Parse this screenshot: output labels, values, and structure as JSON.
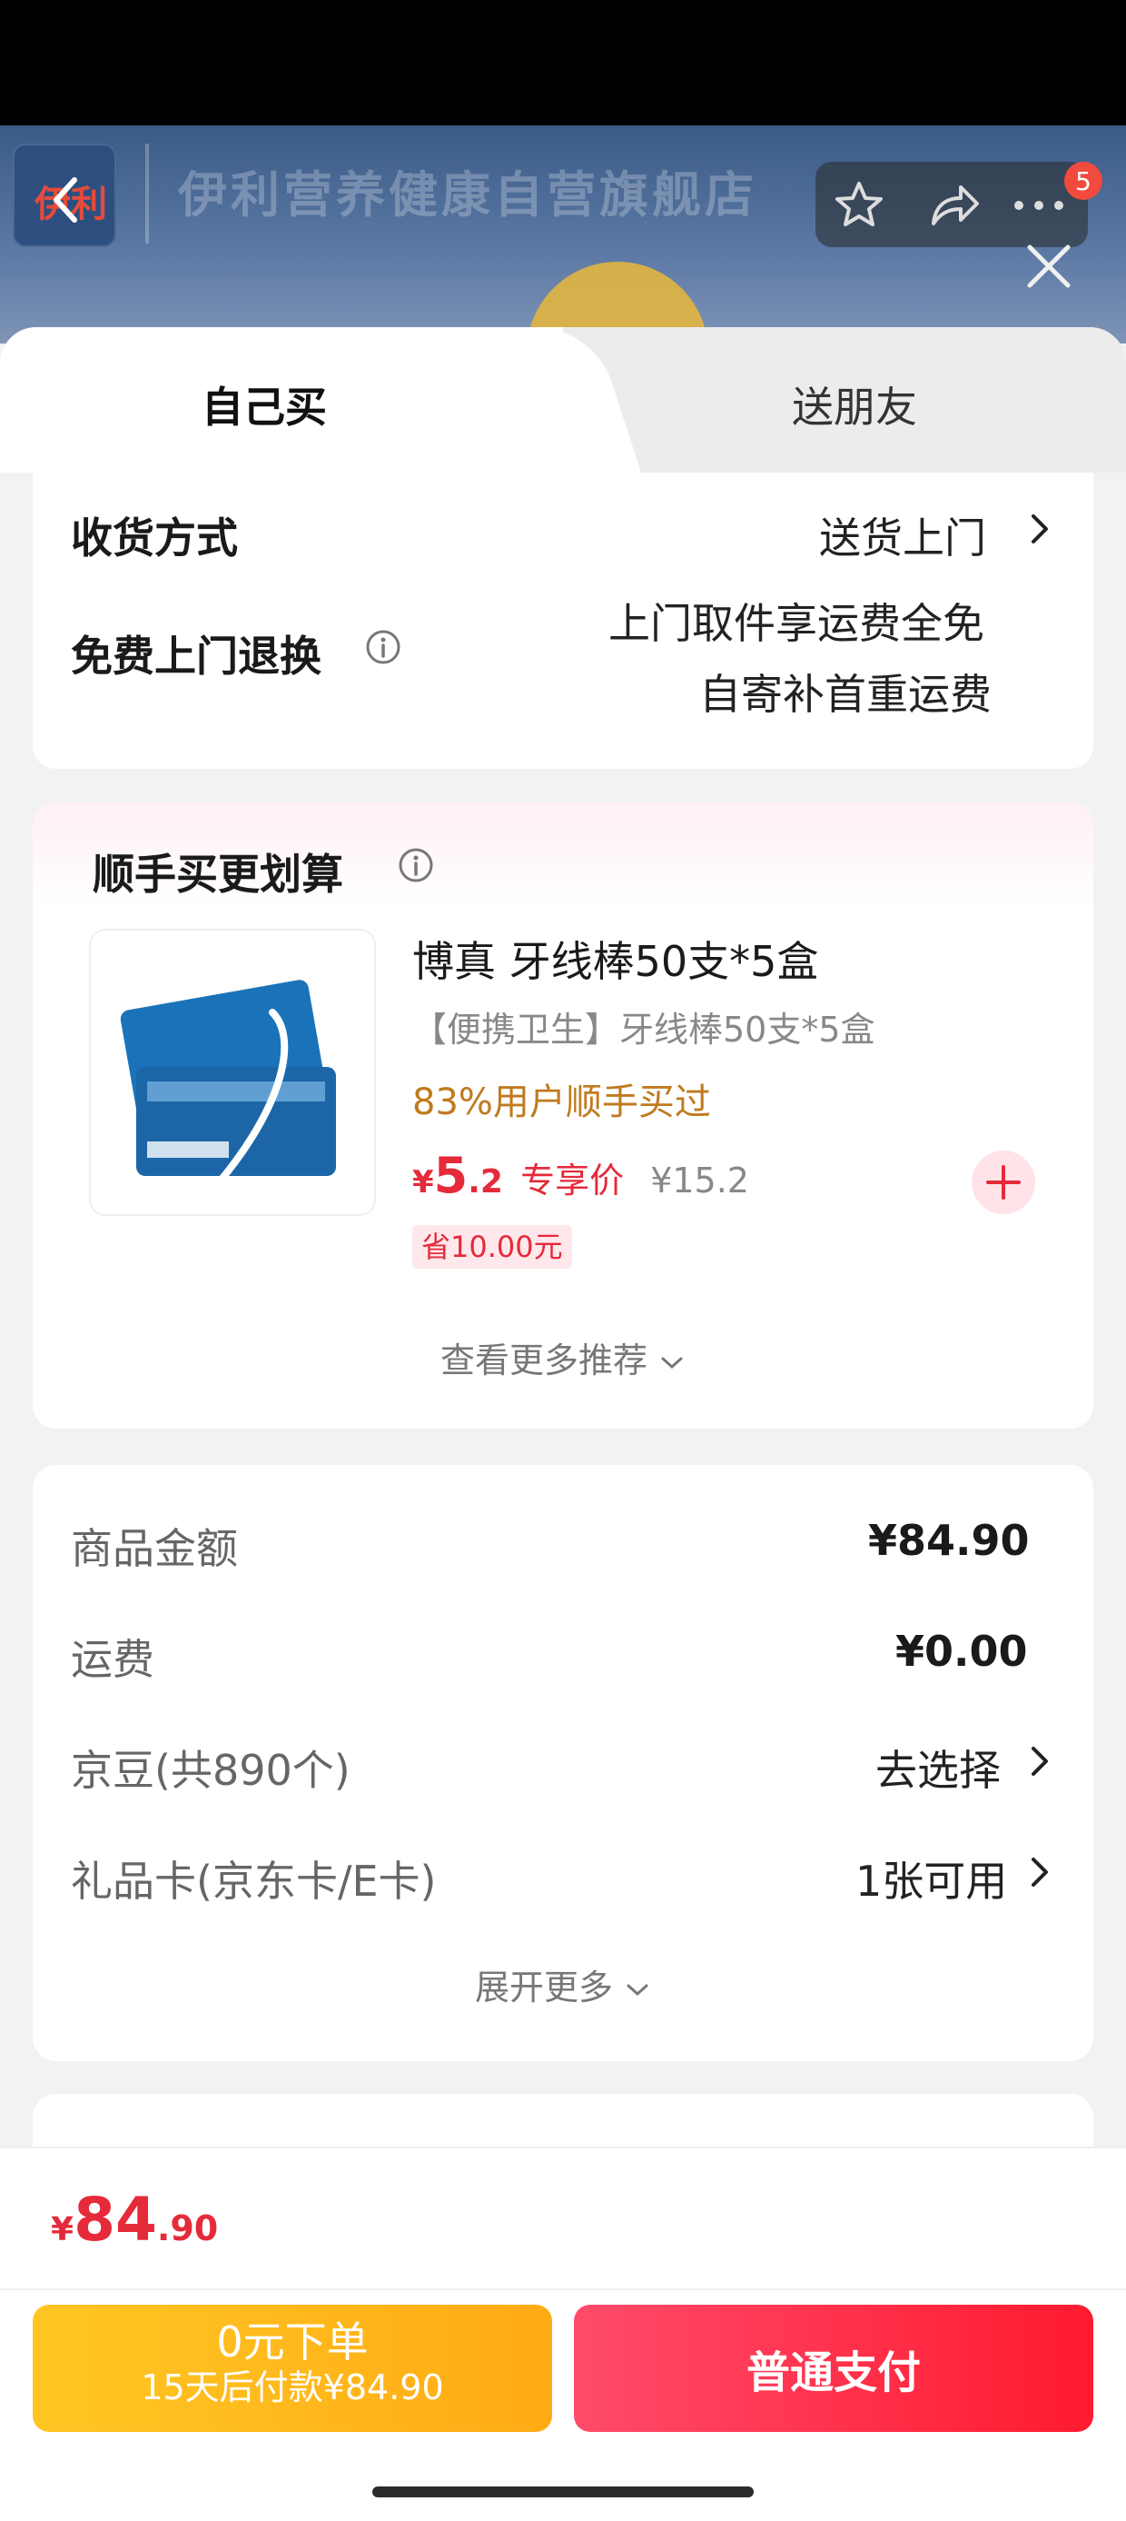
{
  "store": {
    "logo_text": "伊利",
    "name": "伊利营养健康自营旗舰店",
    "cart_badge": "5"
  },
  "tabs": [
    {
      "label": "自己买"
    },
    {
      "label": "送朋友"
    }
  ],
  "delivery": {
    "method_label": "收货方式",
    "method_value": "送货上门",
    "return_label": "免费上门退换",
    "return_line1": "上门取件享运费全免",
    "return_line2": "自寄补首重运费"
  },
  "recommend": {
    "title": "顺手买更划算",
    "product": {
      "name": "博真 牙线棒50支*5盒",
      "subtitle": "【便携卫生】牙线棒50支*5盒",
      "social_proof": "83%用户顺手买过",
      "price_symbol": "¥",
      "price_int": "5",
      "price_dec": ".2",
      "price_tag": "专享价",
      "original_price": "¥15.2",
      "save": "省10.00元"
    },
    "more_label": "查看更多推荐"
  },
  "summary": {
    "rows": [
      {
        "label": "商品金额",
        "value": "¥84.90"
      },
      {
        "label": "运费",
        "value": "¥0.00"
      },
      {
        "label": "京豆(共890个)",
        "value": "去选择"
      },
      {
        "label": "礼品卡(京东卡/E卡)",
        "value": "1张可用"
      }
    ],
    "expand_label": "展开更多"
  },
  "footer": {
    "total_symbol": "¥",
    "total_int": "84",
    "total_dec": ".90",
    "pay_later_title": "0元下单",
    "pay_later_sub": "15天后付款¥84.90",
    "pay_now": "普通支付"
  },
  "colors": {
    "price_red": "#e52a3a",
    "gold": "#c07a1e",
    "pay_now_bg": "#ff1a2e",
    "pay_later_bg": "#ffb81a"
  }
}
